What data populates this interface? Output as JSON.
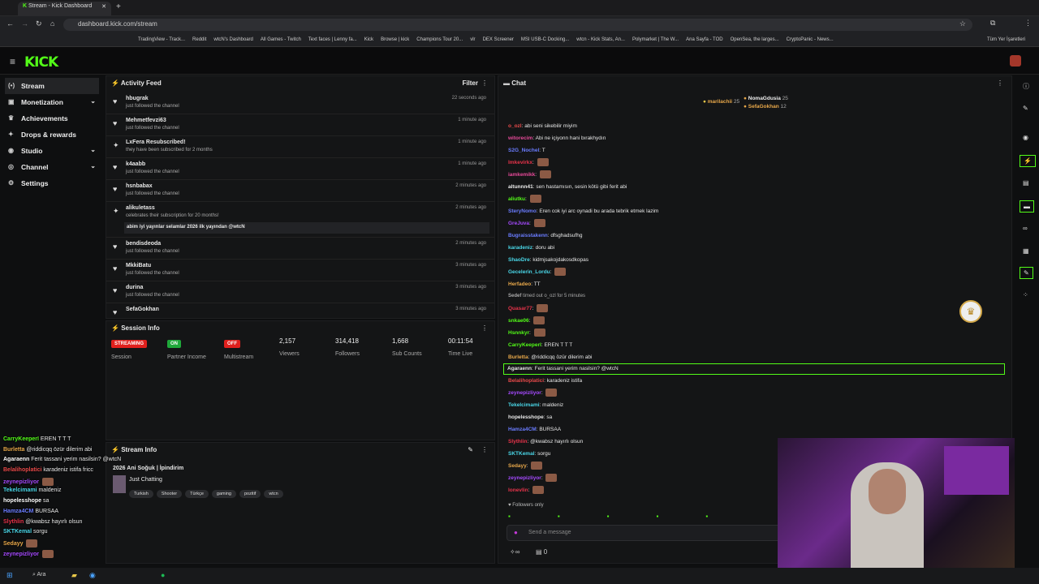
{
  "browser": {
    "tab_title": "Stream - Kick Dashboard",
    "url": "dashboard.kick.com/stream",
    "bookmarks": [
      "TradingView - Track...",
      "Reddit",
      "wtcN's Dashboard",
      "All Games - Twitch",
      "Text faces | Lenny fa...",
      "Kick",
      "Browse | kick",
      "Champions Tour 20...",
      "vlr",
      "DEX Screener",
      "MSI USB-C Docking...",
      "wtcn - Kick Stats, An...",
      "Polymarket | The W...",
      "Ana Sayfa - TOD",
      "OpenSea, the larges...",
      "CryptoPanic - News..."
    ],
    "all_bookmarks": "Tüm Yer İşaretleri"
  },
  "logo": "KICK",
  "sidebar": {
    "items": [
      {
        "label": "Stream",
        "icon": "stream-icon"
      },
      {
        "label": "Monetization",
        "icon": "dollar-icon"
      },
      {
        "label": "Achievements",
        "icon": "trophy-icon"
      },
      {
        "label": "Drops & rewards",
        "icon": "gift-icon"
      },
      {
        "label": "Studio",
        "icon": "studio-icon"
      },
      {
        "label": "Channel",
        "icon": "channel-icon"
      },
      {
        "label": "Settings",
        "icon": "gear-icon"
      }
    ]
  },
  "activity": {
    "title": "Activity Feed",
    "filter": "Filter",
    "items": [
      {
        "name": "hbugrak",
        "sub": "just followed the channel",
        "time": "22 seconds ago"
      },
      {
        "name": "Mehmetfevzi63",
        "sub": "just followed the channel",
        "time": "1 minute ago"
      },
      {
        "name": "LxFera Resubscribed!",
        "sub": "they have been subscribed for 2 months",
        "time": "1 minute ago"
      },
      {
        "name": "k4aabb",
        "sub": "just followed the channel",
        "time": "1 minute ago"
      },
      {
        "name": "hsnbabax",
        "sub": "just followed the channel",
        "time": "2 minutes ago"
      },
      {
        "name": "alikuletass",
        "sub": "celebrates their subscription for 20 months!",
        "time": "2 minutes ago",
        "message": "abim iyi yayınlar selamlar 2026 ilk yayından @wtcN"
      },
      {
        "name": "bendisdeoda",
        "sub": "just followed the channel",
        "time": "2 minutes ago"
      },
      {
        "name": "MkkiBatu",
        "sub": "just followed the channel",
        "time": "3 minutes ago"
      },
      {
        "name": "durina",
        "sub": "just followed the channel",
        "time": "3 minutes ago"
      },
      {
        "name": "SefaGokhan",
        "sub": "",
        "time": "3 minutes ago"
      }
    ]
  },
  "session": {
    "title": "Session Info",
    "cols": [
      {
        "badge": "STREAMING",
        "badge_color": "#e0201d",
        "label": "Session"
      },
      {
        "badge": "ON",
        "badge_color": "#1fa83a",
        "label": "Partner Income"
      },
      {
        "badge": "OFF",
        "badge_color": "#e0201d",
        "label": "Multistream"
      },
      {
        "value": "2,157",
        "label": "Viewers"
      },
      {
        "value": "314,418",
        "label": "Followers"
      },
      {
        "value": "1,668",
        "label": "Sub Counts"
      },
      {
        "value": "00:11:54",
        "label": "Time Live"
      }
    ]
  },
  "stream_info": {
    "title": "Stream Info",
    "stream_title": "2026 Ani Soğuk | İpindirim",
    "category": "Just Chatting",
    "tags": [
      "Turkish",
      "Shooter",
      "Türkçe",
      "gaming",
      "pozitif",
      "wtcn"
    ]
  },
  "chat": {
    "title": "Chat",
    "top_gifters": [
      {
        "name": "marilachii",
        "count": "25"
      },
      {
        "name": "NomaGdusia",
        "count": "25"
      },
      {
        "name": "SefaGokhan",
        "count": "12"
      }
    ],
    "messages": [
      {
        "user": "o_ozl",
        "color": "#e84a4a",
        "text": "abi seni sikebilir miyim"
      },
      {
        "user": "witorecim",
        "color": "#e84a9a",
        "text": "Abi ne içiyonn hani bırakhydın"
      },
      {
        "user": "S2G_Nochel",
        "color": "#6a7cff",
        "text": "T"
      },
      {
        "user": "lmkevirkx",
        "color": "#e8334a",
        "text": "",
        "emote": true
      },
      {
        "user": "iamkemikk",
        "color": "#e84a9a",
        "text": "",
        "emote": true
      },
      {
        "user": "altunnn41",
        "color": "#eeeeee",
        "text": "sen hastamısın, sesin kötü gibi ferit abi"
      },
      {
        "user": "aliutku",
        "color": "#53fc18",
        "text": "",
        "emote": true
      },
      {
        "user": "SteryNomo",
        "color": "#6a7cff",
        "text": "Eren cok iyi arc oynadi bu arada tebrik etmek lazim"
      },
      {
        "user": "GreJuva",
        "color": "#a64aff",
        "text": "",
        "emote": true
      },
      {
        "user": "Bugraisstakenn",
        "color": "#6a7cff",
        "text": "dfsghadsufhg"
      },
      {
        "user": "karadeniz",
        "color": "#4ad7e8",
        "text": "doru abi"
      },
      {
        "user": "ShaoDre",
        "color": "#4ad7e8",
        "text": "kidmjsakojdakosdkopas"
      },
      {
        "user": "Gecelerin_Lordu",
        "color": "#4ad7e8",
        "text": "",
        "emote": true
      },
      {
        "user": "Herfadeo",
        "color": "#e8a84a",
        "text": "TT"
      },
      {
        "user": "Sedef",
        "color": "#aaaaaa",
        "text": "timed out o_ozl for 5 minutes",
        "system": true
      },
      {
        "user": "Quasar77",
        "color": "#e8334a",
        "text": "",
        "emote": true
      },
      {
        "user": "snkae06",
        "color": "#53fc18",
        "text": "",
        "emote": true
      },
      {
        "user": "Hsnnkyr",
        "color": "#53fc18",
        "text": "",
        "emote": true
      },
      {
        "user": "CarryKeeperl",
        "color": "#53fc18",
        "text": "EREN T T T"
      },
      {
        "user": "Burletta",
        "color": "#e8a84a",
        "text": "@riddicqq özür dilerim abi"
      },
      {
        "user": "Agaraenn",
        "color": "#e8e8e8",
        "text": "Ferit tassani yerim nasilsin? @wtcN",
        "highlight": true
      },
      {
        "user": "Belalihoplatici",
        "color": "#e84a4a",
        "text": "karadeniz istifa"
      },
      {
        "user": "zeynepizliyor",
        "color": "#a64aff",
        "text": "",
        "emote": true
      },
      {
        "user": "Tekelcimami",
        "color": "#4ad7e8",
        "text": "maldeniz"
      },
      {
        "user": "hopelesshope",
        "color": "#e8e8e8",
        "text": "sa"
      },
      {
        "user": "Hamza4CM",
        "color": "#6a7cff",
        "text": "BURSAA"
      },
      {
        "user": "Slythlin",
        "color": "#e8334a",
        "text": "@kwabsz hayırlı olsun"
      },
      {
        "user": "SKTKemal",
        "color": "#4ad7e8",
        "text": "sorgu"
      },
      {
        "user": "Sedayy",
        "color": "#e8a84a",
        "text": "",
        "emote": true
      },
      {
        "user": "zeynepizliyor",
        "color": "#a64aff",
        "text": "",
        "emote": true
      },
      {
        "user": "lonevlin",
        "color": "#e8334a",
        "text": "",
        "emote": true
      }
    ],
    "followers_only": "Followers only",
    "placeholder": "Send a message",
    "count": "0"
  },
  "overlay": [
    {
      "user": "CarryKeeperl",
      "color": "#53fc18",
      "text": "EREN T T T"
    },
    {
      "user": "Burletta",
      "color": "#e8a84a",
      "text": "@riddicqq özür dilerim abi"
    },
    {
      "user": "Agaraenn",
      "color": "#ffffff",
      "text": "Ferit tassani yerim nasilsin? @wtcN"
    },
    {
      "user": "Belalihoplatici",
      "color": "#e84a4a",
      "text": "karadeniz istifa fricc"
    },
    {
      "user": "zeynepizliyor",
      "color": "#a64aff",
      "text": ""
    },
    {
      "user": "Tekelcimami",
      "color": "#4ad7e8",
      "text": "maldeniz"
    },
    {
      "user": "hopelesshope",
      "color": "#ffffff",
      "text": "sa"
    },
    {
      "user": "Hamza4CM",
      "color": "#6a7cff",
      "text": "BURSAA"
    },
    {
      "user": "Slythlin",
      "color": "#e8334a",
      "text": "@kwabsz hayırlı olsun"
    },
    {
      "user": "SKTKemal",
      "color": "#4ad7e8",
      "text": "sorgu"
    },
    {
      "user": "Sedayy",
      "color": "#e8a84a",
      "text": ""
    },
    {
      "user": "zeynepizliyor",
      "color": "#a64aff",
      "text": ""
    }
  ],
  "taskbar": {
    "search": "Ara"
  }
}
